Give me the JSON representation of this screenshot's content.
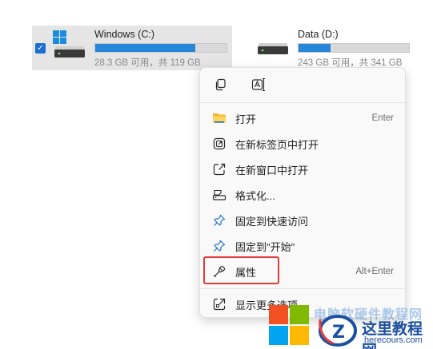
{
  "drives": [
    {
      "name": "Windows (C:)",
      "free_text": "28.3 GB 可用，共 119 GB",
      "used_fraction": 0.76,
      "selected": true
    },
    {
      "name": "Data (D:)",
      "free_text": "243 GB 可用，共 341 GB",
      "used_fraction": 0.29,
      "selected": false
    }
  ],
  "menu": {
    "quick_actions": [
      {
        "icon": "copy-icon"
      },
      {
        "icon": "rename-icon"
      }
    ],
    "items": [
      {
        "icon": "folder-open-icon",
        "label": "打开",
        "shortcut": "Enter"
      },
      {
        "icon": "new-tab-icon",
        "label": "在新标签页中打开",
        "shortcut": ""
      },
      {
        "icon": "new-window-icon",
        "label": "在新窗口中打开",
        "shortcut": ""
      },
      {
        "icon": "format-drive-icon",
        "label": "格式化...",
        "shortcut": ""
      },
      {
        "icon": "pin-icon",
        "label": "固定到快速访问",
        "shortcut": ""
      },
      {
        "icon": "pin-icon",
        "label": "固定到\"开始\"",
        "shortcut": ""
      },
      {
        "icon": "wrench-icon",
        "label": "属性",
        "shortcut": "Alt+Enter"
      },
      {
        "icon": "more-options-icon",
        "label": "显示更多选项",
        "shortcut": ""
      }
    ]
  },
  "watermark": {
    "brand_top": "电脑软硬件教程网",
    "site_name": "这里教程网",
    "url": "herecours.com"
  },
  "colors": {
    "accent": "#2786d8",
    "selection_bg": "#e5e5e5",
    "highlight_border": "#e23b3b",
    "watermark_blue": "#1b4fa0"
  }
}
